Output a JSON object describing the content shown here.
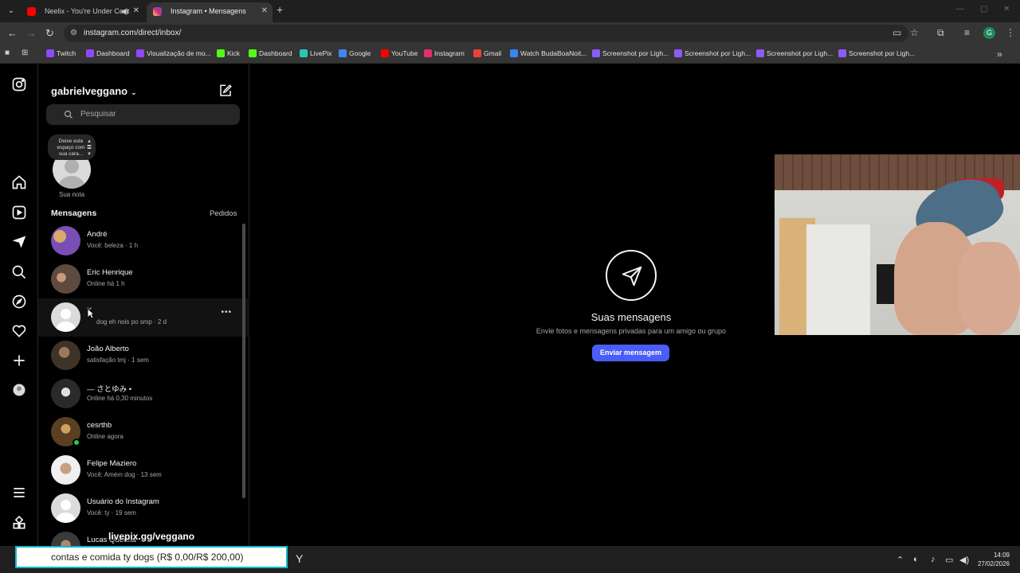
{
  "browser": {
    "tabs": [
      {
        "title": "Neelix - You're Under Cont",
        "favicon_color": "#ff0000"
      },
      {
        "title": "Instagram • Mensagens",
        "favicon_color": "#e1306c"
      }
    ],
    "url": "instagram.com/direct/inbox/",
    "profile_initial": "G",
    "bookmarks": [
      {
        "label": "Twitch",
        "color": "#9146ff"
      },
      {
        "label": "Dashboard",
        "color": "#9146ff"
      },
      {
        "label": "Visualização de mo...",
        "color": "#9146ff"
      },
      {
        "label": "Kick",
        "color": "#53fc18"
      },
      {
        "label": "Dashboard",
        "color": "#53fc18"
      },
      {
        "label": "LivePix",
        "color": "#2ec4b6"
      },
      {
        "label": "Google",
        "color": "#4285f4"
      },
      {
        "label": "YouTube",
        "color": "#ff0000"
      },
      {
        "label": "Instagram",
        "color": "#e1306c"
      },
      {
        "label": "Gmail",
        "color": "#ea4335"
      },
      {
        "label": "Watch BudaBoaNoit...",
        "color": "#3b82f6"
      },
      {
        "label": "Screenshot por Ligh...",
        "color": "#8b5cf6"
      },
      {
        "label": "Screenshot por Ligh...",
        "color": "#8b5cf6"
      },
      {
        "label": "Screenshot por Ligh...",
        "color": "#8b5cf6"
      },
      {
        "label": "Screenshot por Ligh...",
        "color": "#8b5cf6"
      }
    ]
  },
  "inbox": {
    "username": "gabrielveggano",
    "search_placeholder": "Pesquisar",
    "note_bubble": "Deixe este espaço com sua cara...",
    "note_label": "Sua nota",
    "section_title": "Mensagens",
    "requests_label": "Pedidos",
    "conversations": [
      {
        "name": "André",
        "subtitle": "Você: beleza · 1 h",
        "avatar_color": "#7a4fb5"
      },
      {
        "name": "Eric Henrique",
        "subtitle": "Online há 1 h",
        "avatar_color": "#6b5a4e"
      },
      {
        "name": "K",
        "subtitle": "dog eh nois po smp · 2 d",
        "avatar_color": "#dbdbdb"
      },
      {
        "name": "João Alberto",
        "subtitle": "satisfação tmj · 1 sem",
        "avatar_color": "#5b4a3a"
      },
      {
        "name": "— さとゆみ •",
        "subtitle": "Online há 0,30 minutos",
        "avatar_color": "#3a3a3a"
      },
      {
        "name": "cesrthb",
        "subtitle": "Online agora",
        "avatar_color": "#8a6a3a"
      },
      {
        "name": "Felipe Maziero",
        "subtitle": "Você: Amém dog · 13 sem",
        "avatar_color": "#b09070"
      },
      {
        "name": "Usuário do Instagram",
        "subtitle": "Você: ty · 19 sem",
        "avatar_color": "#dbdbdb"
      },
      {
        "name": "Lucas Quereia",
        "subtitle": "",
        "avatar_color": "#4a4a4a"
      }
    ]
  },
  "main": {
    "title": "Suas mensagens",
    "subtitle": "Envie fotos e mensagens privadas para um amigo ou grupo",
    "button": "Enviar mensagem"
  },
  "stream_overlay": {
    "link": "livepix.gg/veggano",
    "donation": "contas e comida ty dogs (R$ 0,00/R$ 200,00)",
    "donation_progress": 0
  },
  "taskbar": {
    "time": "14:09",
    "date": "27/02/2026"
  }
}
